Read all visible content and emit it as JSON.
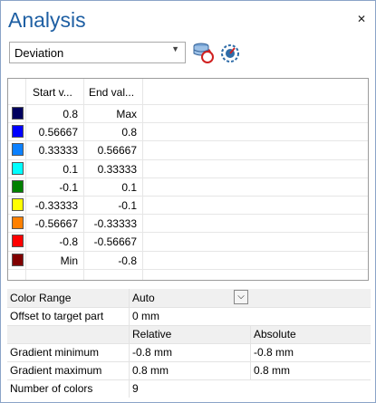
{
  "header": {
    "title": "Analysis",
    "close_glyph": "✕"
  },
  "toolbar": {
    "mode_select": "Deviation",
    "icons": [
      "reset-deviation-icon",
      "gauge-settings-icon"
    ]
  },
  "color_scale": {
    "columns": [
      "Start v...",
      "End val..."
    ],
    "rows": [
      {
        "color": "#00005e",
        "start": "0.8",
        "end": "Max"
      },
      {
        "color": "#0000ff",
        "start": "0.56667",
        "end": "0.8"
      },
      {
        "color": "#0b80ff",
        "start": "0.33333",
        "end": "0.56667"
      },
      {
        "color": "#00ffff",
        "start": "0.1",
        "end": "0.33333"
      },
      {
        "color": "#008000",
        "start": "-0.1",
        "end": "0.1"
      },
      {
        "color": "#ffff00",
        "start": "-0.33333",
        "end": "-0.1"
      },
      {
        "color": "#ff8000",
        "start": "-0.56667",
        "end": "-0.33333"
      },
      {
        "color": "#ff0000",
        "start": "-0.8",
        "end": "-0.56667"
      },
      {
        "color": "#800000",
        "start": "Min",
        "end": "-0.8"
      }
    ]
  },
  "properties": {
    "color_range_label": "Color Range",
    "color_range_value": "Auto",
    "offset_label": "Offset to target part",
    "offset_value": "0 mm",
    "relative_header": "Relative",
    "absolute_header": "Absolute",
    "grad_min_label": "Gradient minimum",
    "grad_min_rel": "-0.8 mm",
    "grad_min_abs": "-0.8 mm",
    "grad_max_label": "Gradient maximum",
    "grad_max_rel": "0.8 mm",
    "grad_max_abs": "0.8 mm",
    "num_colors_label": "Number of colors",
    "num_colors_value": "9"
  }
}
